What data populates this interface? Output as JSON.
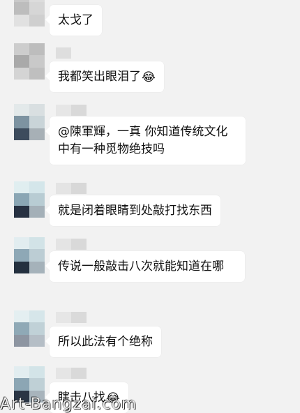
{
  "messages": [
    {
      "text": "太戈了",
      "emoji": ""
    },
    {
      "text": "我都笑出眼泪了",
      "emoji": "😂"
    },
    {
      "text": "@陳軍輝，一真 你知道传统文化中有一种觅物绝技吗",
      "emoji": ""
    },
    {
      "text": "就是闭着眼睛到处敲打找东西",
      "emoji": ""
    },
    {
      "text": "传说一般敲击八次就能知道在哪",
      "emoji": ""
    },
    {
      "text": "所以此法有个绝称",
      "emoji": ""
    },
    {
      "text": "瞎击八找",
      "emoji": "😂"
    }
  ],
  "watermark": "Art-Bangzai.com",
  "colors": {
    "background": "#f2f2f2",
    "bubble": "#ffffff",
    "text": "#111111"
  }
}
